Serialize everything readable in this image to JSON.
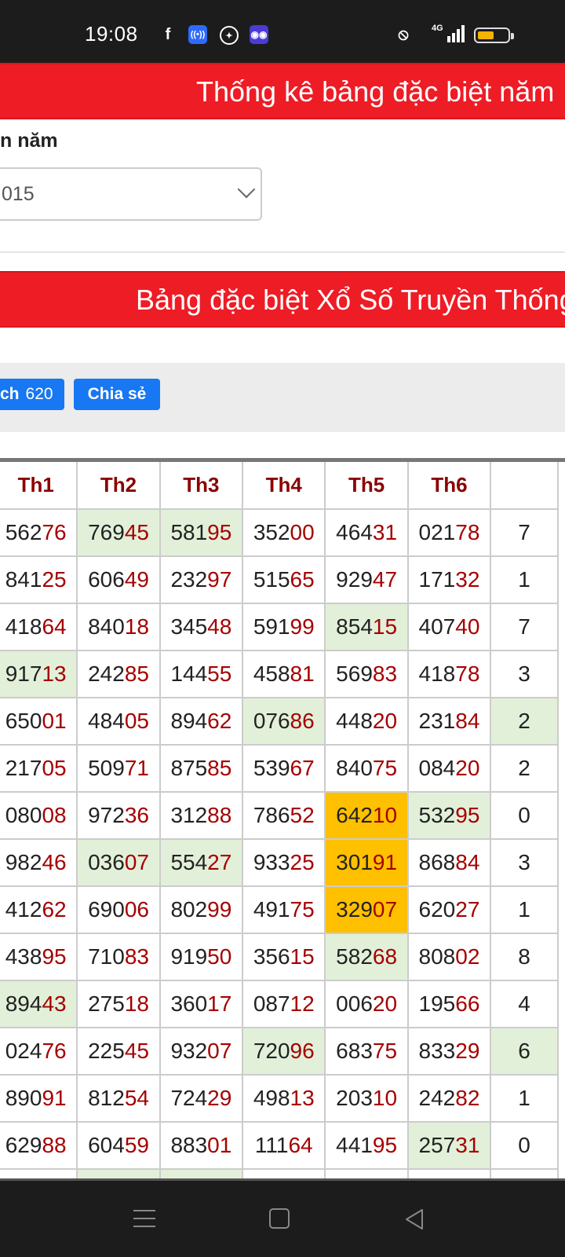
{
  "status_bar": {
    "time": "19:08",
    "icons": [
      "facebook-icon",
      "hotspot-icon",
      "compass-icon",
      "game-icon"
    ],
    "right_icons": [
      "vibrate-off-icon",
      "signal-4g-icon",
      "battery-icon"
    ],
    "network": "4G"
  },
  "banner1": {
    "title": "Thống kê bảng đặc biệt năm"
  },
  "year_selector": {
    "label": "n năm",
    "value": "015"
  },
  "banner2": {
    "title": "Bảng đặc biệt Xổ Số Truyền Thống"
  },
  "share": {
    "like_label": "ch",
    "like_count": "620",
    "share_label": "Chia sẻ"
  },
  "table": {
    "headers": [
      "Th1",
      "Th2",
      "Th3",
      "Th4",
      "Th5",
      "Th6",
      ""
    ],
    "rows": [
      [
        {
          "h": "562",
          "t": "76"
        },
        {
          "h": "769",
          "t": "45",
          "c": "g"
        },
        {
          "h": "581",
          "t": "95",
          "c": "g"
        },
        {
          "h": "352",
          "t": "00"
        },
        {
          "h": "464",
          "t": "31"
        },
        {
          "h": "021",
          "t": "78"
        },
        {
          "h": "7",
          "t": ""
        }
      ],
      [
        {
          "h": "841",
          "t": "25"
        },
        {
          "h": "606",
          "t": "49"
        },
        {
          "h": "232",
          "t": "97"
        },
        {
          "h": "515",
          "t": "65"
        },
        {
          "h": "929",
          "t": "47"
        },
        {
          "h": "171",
          "t": "32"
        },
        {
          "h": "1",
          "t": ""
        }
      ],
      [
        {
          "h": "418",
          "t": "64"
        },
        {
          "h": "840",
          "t": "18"
        },
        {
          "h": "345",
          "t": "48"
        },
        {
          "h": "591",
          "t": "99"
        },
        {
          "h": "854",
          "t": "15",
          "c": "g"
        },
        {
          "h": "407",
          "t": "40"
        },
        {
          "h": "7",
          "t": ""
        }
      ],
      [
        {
          "h": "917",
          "t": "13",
          "c": "g"
        },
        {
          "h": "242",
          "t": "85"
        },
        {
          "h": "144",
          "t": "55"
        },
        {
          "h": "458",
          "t": "81"
        },
        {
          "h": "569",
          "t": "83"
        },
        {
          "h": "418",
          "t": "78"
        },
        {
          "h": "3",
          "t": ""
        }
      ],
      [
        {
          "h": "650",
          "t": "01"
        },
        {
          "h": "484",
          "t": "05"
        },
        {
          "h": "894",
          "t": "62"
        },
        {
          "h": "076",
          "t": "86",
          "c": "g"
        },
        {
          "h": "448",
          "t": "20"
        },
        {
          "h": "231",
          "t": "84"
        },
        {
          "h": "2",
          "t": "",
          "c": "g"
        }
      ],
      [
        {
          "h": "217",
          "t": "05"
        },
        {
          "h": "509",
          "t": "71"
        },
        {
          "h": "875",
          "t": "85"
        },
        {
          "h": "539",
          "t": "67"
        },
        {
          "h": "840",
          "t": "75"
        },
        {
          "h": "084",
          "t": "20"
        },
        {
          "h": "2",
          "t": ""
        }
      ],
      [
        {
          "h": "080",
          "t": "08"
        },
        {
          "h": "972",
          "t": "36"
        },
        {
          "h": "312",
          "t": "88"
        },
        {
          "h": "786",
          "t": "52"
        },
        {
          "h": "642",
          "t": "10",
          "c": "o"
        },
        {
          "h": "532",
          "t": "95",
          "c": "g"
        },
        {
          "h": "0",
          "t": ""
        }
      ],
      [
        {
          "h": "982",
          "t": "46"
        },
        {
          "h": "036",
          "t": "07",
          "c": "g"
        },
        {
          "h": "554",
          "t": "27",
          "c": "g"
        },
        {
          "h": "933",
          "t": "25"
        },
        {
          "h": "301",
          "t": "91",
          "c": "o"
        },
        {
          "h": "868",
          "t": "84"
        },
        {
          "h": "3",
          "t": ""
        }
      ],
      [
        {
          "h": "412",
          "t": "62"
        },
        {
          "h": "690",
          "t": "06"
        },
        {
          "h": "802",
          "t": "99"
        },
        {
          "h": "491",
          "t": "75"
        },
        {
          "h": "329",
          "t": "07",
          "c": "o"
        },
        {
          "h": "620",
          "t": "27"
        },
        {
          "h": "1",
          "t": ""
        }
      ],
      [
        {
          "h": "438",
          "t": "95"
        },
        {
          "h": "710",
          "t": "83"
        },
        {
          "h": "919",
          "t": "50"
        },
        {
          "h": "356",
          "t": "15"
        },
        {
          "h": "582",
          "t": "68",
          "c": "g"
        },
        {
          "h": "808",
          "t": "02"
        },
        {
          "h": "8",
          "t": ""
        }
      ],
      [
        {
          "h": "894",
          "t": "43",
          "c": "g"
        },
        {
          "h": "275",
          "t": "18"
        },
        {
          "h": "360",
          "t": "17"
        },
        {
          "h": "087",
          "t": "12"
        },
        {
          "h": "006",
          "t": "20"
        },
        {
          "h": "195",
          "t": "66"
        },
        {
          "h": "4",
          "t": ""
        }
      ],
      [
        {
          "h": "024",
          "t": "76"
        },
        {
          "h": "225",
          "t": "45"
        },
        {
          "h": "932",
          "t": "07"
        },
        {
          "h": "720",
          "t": "96",
          "c": "g"
        },
        {
          "h": "683",
          "t": "75"
        },
        {
          "h": "833",
          "t": "29"
        },
        {
          "h": "6",
          "t": "",
          "c": "g"
        }
      ],
      [
        {
          "h": "890",
          "t": "91"
        },
        {
          "h": "812",
          "t": "54"
        },
        {
          "h": "724",
          "t": "29"
        },
        {
          "h": "498",
          "t": "13"
        },
        {
          "h": "203",
          "t": "10"
        },
        {
          "h": "242",
          "t": "82"
        },
        {
          "h": "1",
          "t": ""
        }
      ],
      [
        {
          "h": "629",
          "t": "88"
        },
        {
          "h": "604",
          "t": "59"
        },
        {
          "h": "883",
          "t": "01"
        },
        {
          "h": "111",
          "t": "64"
        },
        {
          "h": "441",
          "t": "95"
        },
        {
          "h": "257",
          "t": "31",
          "c": "g"
        },
        {
          "h": "0",
          "t": ""
        }
      ],
      [
        {
          "h": "",
          "t": ""
        },
        {
          "h": "",
          "t": "",
          "c": "g"
        },
        {
          "h": "",
          "t": "",
          "c": "g"
        },
        {
          "h": "",
          "t": ""
        },
        {
          "h": "",
          "t": ""
        },
        {
          "h": "",
          "t": ""
        },
        {
          "h": "",
          "t": ""
        }
      ]
    ]
  },
  "nav": {
    "icons": [
      "menu-icon",
      "home-icon",
      "back-icon"
    ]
  }
}
